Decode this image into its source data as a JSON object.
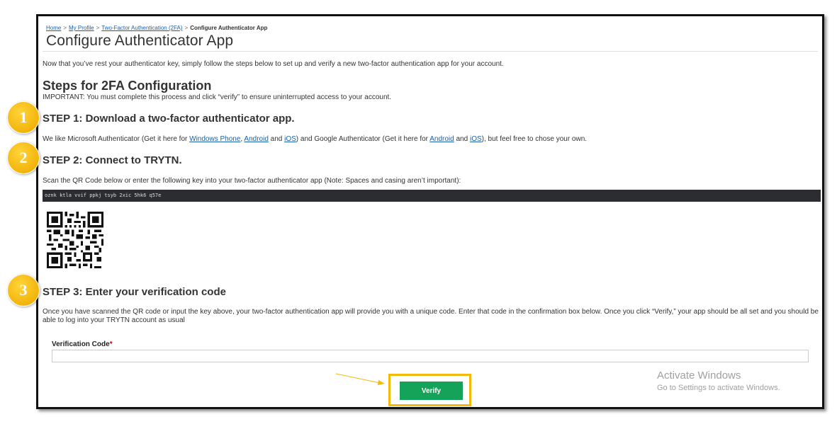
{
  "breadcrumb": {
    "home": "Home",
    "profile": "My Profile",
    "twofa": "Two-Factor Authentication (2FA)",
    "current": "Configure Authenticator App",
    "sep": ">"
  },
  "page_title": "Configure Authenticator App",
  "intro": "Now that you’ve rest your authenticator key, simply follow the steps below to set up and verify a new two-factor authentication app for your account.",
  "steps_heading": "Steps for 2FA Configuration",
  "important": "IMPORTANT: You must complete this process and click “verify” to ensure uninterrupted access to your account.",
  "step1": {
    "heading": "STEP 1: Download a two-factor authenticator app.",
    "text_a": "We like Microsoft Authenticator (Get it here for ",
    "link_windows": "Windows Phone",
    "comma": ", ",
    "link_android1": "Android",
    "and1": " and ",
    "link_ios1": "iOS",
    "text_b": ") and Google Authenticator (Get it here for ",
    "link_android2": "Android",
    "and2": " and ",
    "link_ios2": "iOS",
    "text_c": "), but feel free to chose your own."
  },
  "step2": {
    "heading": "STEP 2: Connect to TRYTN.",
    "text": "Scan the QR Code below or enter the following key into your two-factor authenticator app (Note: Spaces and casing aren’t important):",
    "key": "oznk ktla vvif ppkj tsyb 2xic 5hk6 q57e"
  },
  "step3": {
    "heading": "STEP 3: Enter your verification code",
    "text": "Once you have scanned the QR code or input the key above, your two-factor authentication app will provide you with a unique code. Enter that code in the confirmation box below. Once you click “Verify,” your app should be all set and you should be able to log into your TRYTN account as usual"
  },
  "form": {
    "label": "Verification Code",
    "required_mark": "*",
    "value": "",
    "button": "Verify"
  },
  "watermark": {
    "line1": "Activate Windows",
    "line2": "Go to Settings to activate Windows."
  },
  "badges": [
    "1",
    "2",
    "3"
  ],
  "colors": {
    "badge": "#f2b40a",
    "highlight": "#f3b90b",
    "verify_button": "#15a35a",
    "link": "#1a5fa8",
    "key_bar": "#2b2d31"
  },
  "icons": [
    "qr-code-icon",
    "arrow-annotation-icon"
  ]
}
